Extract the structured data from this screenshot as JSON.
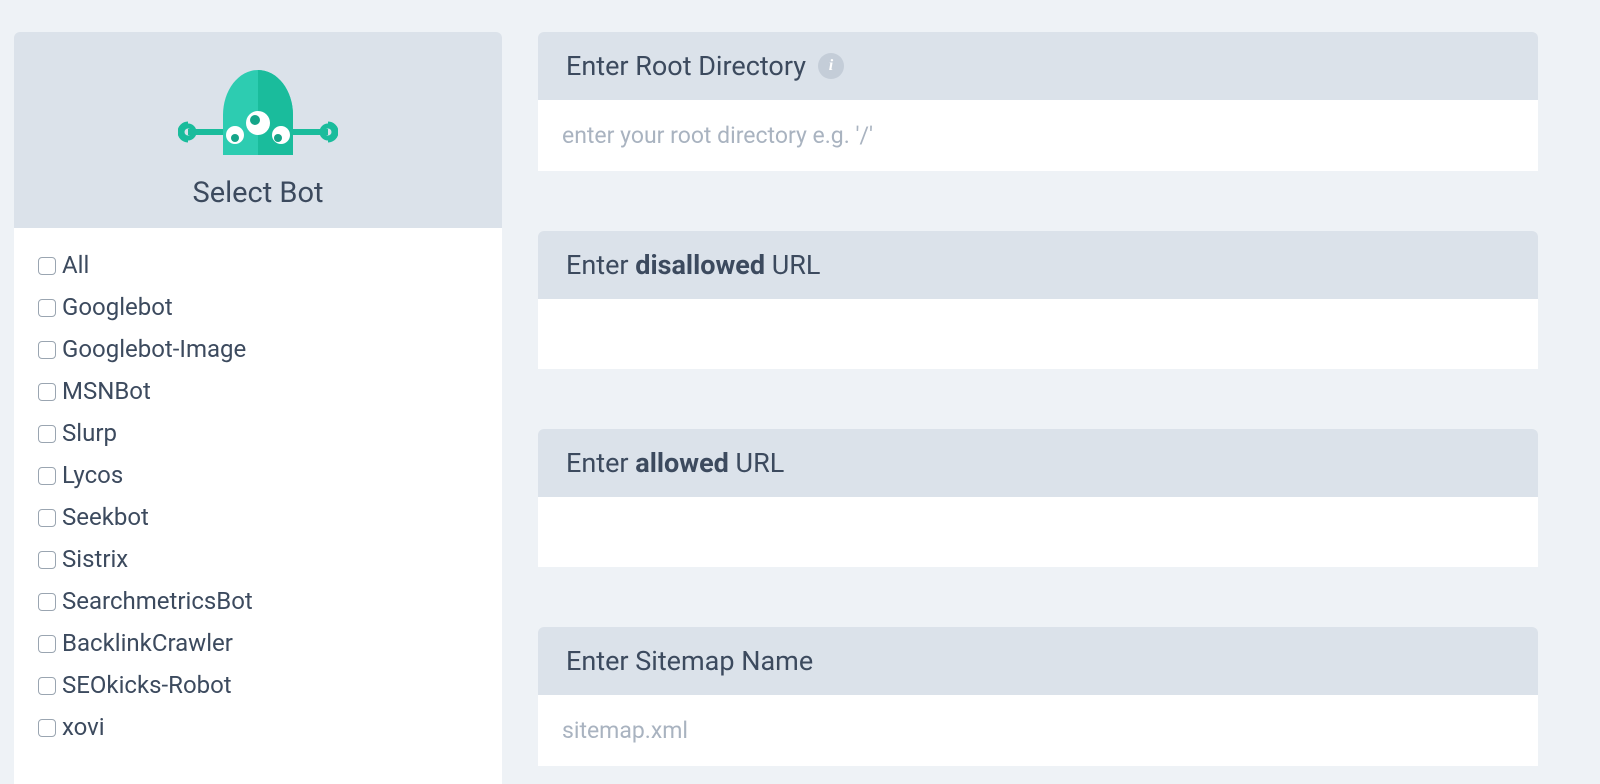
{
  "sidebar": {
    "title": "Select Bot",
    "bots": [
      "All",
      "Googlebot",
      "Googlebot-Image",
      "MSNBot",
      "Slurp",
      "Lycos",
      "Seekbot",
      "Sistrix",
      "SearchmetricsBot",
      "BacklinkCrawler",
      "SEOkicks-Robot",
      "xovi"
    ]
  },
  "sections": {
    "root_dir": {
      "label": "Enter Root Directory",
      "placeholder": "enter your root directory e.g. '/'"
    },
    "disallowed": {
      "prefix": "Enter ",
      "bold": "disallowed",
      "suffix": " URL"
    },
    "allowed": {
      "prefix": "Enter ",
      "bold": "allowed",
      "suffix": " URL"
    },
    "sitemap": {
      "label": "Enter Sitemap Name",
      "placeholder": "sitemap.xml"
    }
  }
}
